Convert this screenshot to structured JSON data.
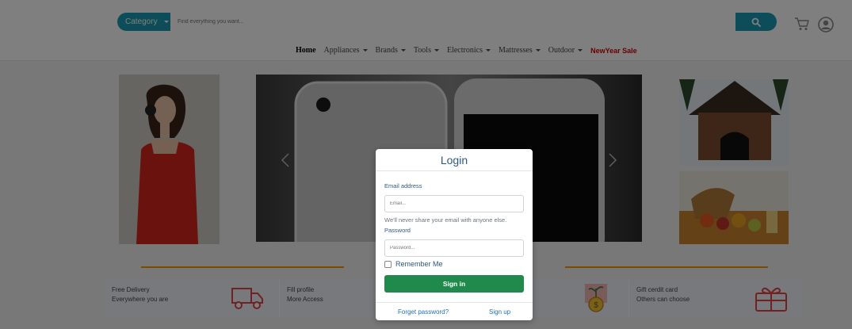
{
  "header": {
    "category_label": "Category",
    "search_placeholder": "Find everything you want..."
  },
  "nav": {
    "items": [
      {
        "label": "Home",
        "dropdown": false
      },
      {
        "label": "Appliances",
        "dropdown": true
      },
      {
        "label": "Brands",
        "dropdown": true
      },
      {
        "label": "Tools",
        "dropdown": true
      },
      {
        "label": "Electronics",
        "dropdown": true
      },
      {
        "label": "Mattresses",
        "dropdown": true
      },
      {
        "label": "Outdoor",
        "dropdown": true
      }
    ],
    "sale_label": "NewYear Sale"
  },
  "features": [
    {
      "line1": "Free Delivery",
      "line2": "Everywhere you are",
      "icon": "delivery-truck-icon"
    },
    {
      "line1": "Fill profile",
      "line2": "More Access",
      "icon": ""
    },
    {
      "line1": "",
      "line2": "",
      "icon": "money-plant-icon"
    },
    {
      "line1": "Gift cerdit card",
      "line2": "Others can choose",
      "icon": "gift-card-icon"
    }
  ],
  "login": {
    "title": "Login",
    "email_label": "Email address",
    "email_placeholder": "Email...",
    "email_help": "We'll never share your email with anyone else.",
    "password_label": "Password",
    "password_placeholder": "Password...",
    "remember_label": "Remember Me",
    "signin_label": "Sign in",
    "forgot_label": "Forget password?",
    "signup_label": "Sign up"
  },
  "colors": {
    "accent": "#1a9bb3",
    "sale": "#d60000",
    "signin": "#1f8a4c",
    "link": "#2670b8",
    "divider": "#e69b12"
  }
}
